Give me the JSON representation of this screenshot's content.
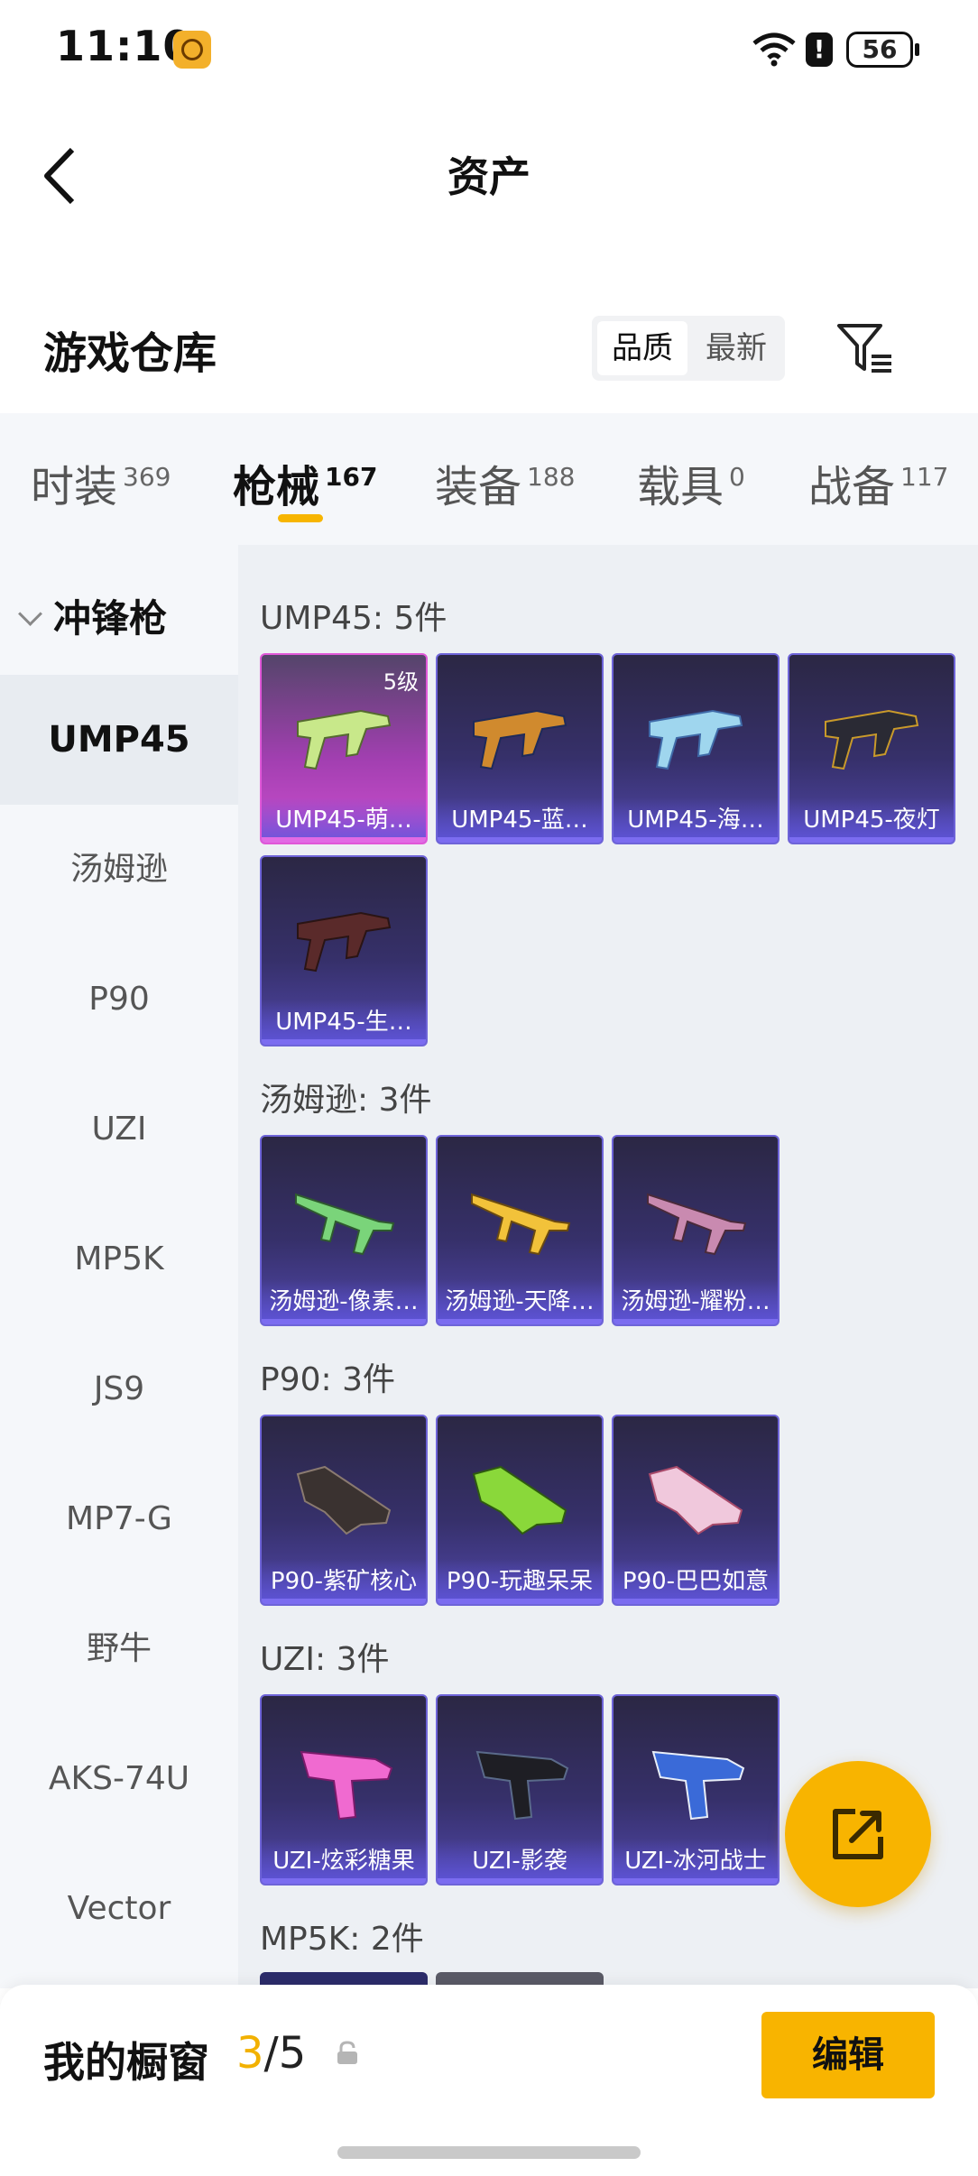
{
  "status_bar": {
    "time": "11:10",
    "alert": "!",
    "battery": "56"
  },
  "header": {
    "title": "资产"
  },
  "warehouse": {
    "title": "游戏仓库",
    "sort_options": [
      "品质",
      "最新"
    ]
  },
  "tabs": [
    {
      "label": "时装",
      "count": "369"
    },
    {
      "label": "枪械",
      "count": "167"
    },
    {
      "label": "装备",
      "count": "188"
    },
    {
      "label": "载具",
      "count": "0"
    },
    {
      "label": "战备",
      "count": "117"
    }
  ],
  "sidebar": {
    "category": "冲锋枪",
    "items": [
      "UMP45",
      "汤姆逊",
      "P90",
      "UZI",
      "MP5K",
      "JS9",
      "MP7-G",
      "野牛",
      "AKS-74U",
      "Vector"
    ]
  },
  "groups": [
    {
      "header": "UMP45: 5件",
      "items": [
        {
          "label": "UMP45-萌…",
          "level": "5级"
        },
        {
          "label": "UMP45-蓝…"
        },
        {
          "label": "UMP45-海…"
        },
        {
          "label": "UMP45-夜灯"
        },
        {
          "label": "UMP45-生…"
        }
      ]
    },
    {
      "header": "汤姆逊: 3件",
      "items": [
        {
          "label": "汤姆逊-像素…"
        },
        {
          "label": "汤姆逊-天降…"
        },
        {
          "label": "汤姆逊-耀粉…"
        }
      ]
    },
    {
      "header": "P90: 3件",
      "items": [
        {
          "label": "P90-紫矿核心"
        },
        {
          "label": "P90-玩趣呆呆"
        },
        {
          "label": "P90-巴巴如意"
        }
      ]
    },
    {
      "header": "UZI: 3件",
      "items": [
        {
          "label": "UZI-炫彩糖果"
        },
        {
          "label": "UZI-影袭"
        },
        {
          "label": "UZI-冰河战士"
        }
      ]
    },
    {
      "header": "MP5K: 2件",
      "items": []
    }
  ],
  "showcase": {
    "label": "我的橱窗",
    "current": "3",
    "total": "/5",
    "edit_label": "编辑"
  },
  "colors": {
    "accent": "#f8b400",
    "card_purple": "#5046a8",
    "card_pink": "#cf4fd0"
  }
}
